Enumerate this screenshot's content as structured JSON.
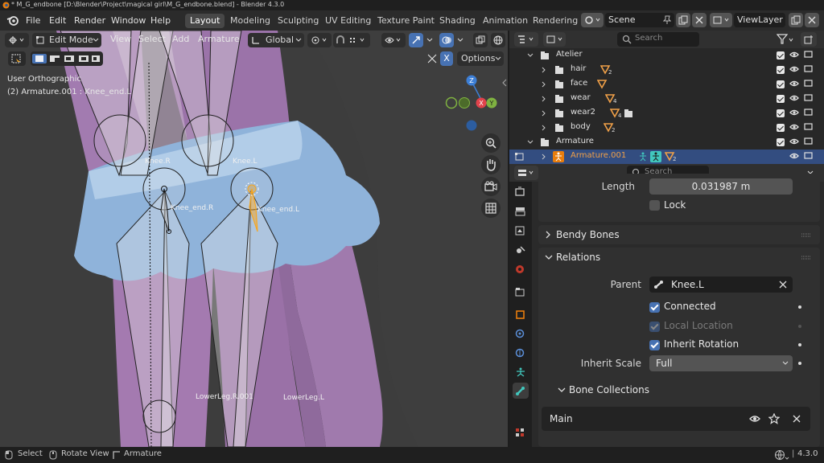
{
  "window": {
    "title": "* M_G_endbone [D:\\Blender\\Project\\magical girl\\M_G_endbone.blend] - Blender 4.3.0"
  },
  "menu": [
    "File",
    "Edit",
    "Render",
    "Window",
    "Help"
  ],
  "workspaces": [
    "Layout",
    "Modeling",
    "Sculpting",
    "UV Editing",
    "Texture Paint",
    "Shading",
    "Animation",
    "Rendering"
  ],
  "active_workspace": "Layout",
  "scene": {
    "name": "Scene",
    "view_layer": "ViewLayer"
  },
  "viewport": {
    "mode": "Edit Mode",
    "header_menus": [
      "View",
      "Select",
      "Add",
      "Armature"
    ],
    "orientation": "Global",
    "options_label": "Options",
    "xray_label": "X",
    "view_name": "User Orthographic",
    "active_object_info": "(2) Armature.001 : Knee_end.L",
    "bone_labels": {
      "knee_r": "Knee.R",
      "knee_l": "Knee.L",
      "knee_end_r": "Knee_end.R",
      "knee_end_l": "Knee_end.L",
      "lowerleg_r": "LowerLeg.R.001",
      "lowerleg_l": "LowerLeg.L"
    },
    "gizmo": {
      "x": "X",
      "y": "Y",
      "z": "Z"
    }
  },
  "outliner": {
    "search_placeholder": "Search",
    "rows": [
      {
        "name": "Atelier",
        "level": 0,
        "expanded": true
      },
      {
        "name": "hair",
        "level": 1,
        "badge": "2"
      },
      {
        "name": "face",
        "level": 1
      },
      {
        "name": "wear",
        "level": 1,
        "badge": "4"
      },
      {
        "name": "wear2",
        "level": 1,
        "badge": "4"
      },
      {
        "name": "body",
        "level": 1,
        "badge": "2"
      },
      {
        "name": "Armature",
        "level": 0,
        "expanded": true
      },
      {
        "name": "Armature.001",
        "level": 1,
        "selected": true,
        "badge": "2"
      }
    ]
  },
  "properties": {
    "search_placeholder": "Search",
    "length_label": "Length",
    "length_value": "0.031987 m",
    "lock_label": "Lock",
    "bendy_bones_label": "Bendy Bones",
    "relations_label": "Relations",
    "parent_label": "Parent",
    "parent_value": "Knee.L",
    "connected_label": "Connected",
    "connected": true,
    "local_location_label": "Local Location",
    "local_location": true,
    "inherit_rotation_label": "Inherit Rotation",
    "inherit_rotation": true,
    "inherit_scale_label": "Inherit Scale",
    "inherit_scale_value": "Full",
    "bone_collections_label": "Bone Collections",
    "collection_name": "Main"
  },
  "statusbar": {
    "select": "Select",
    "rotate": "Rotate View",
    "armature": "Armature",
    "version": "4.3.0"
  },
  "colors": {
    "accent": "#4772b3",
    "selection_row": "#334d80",
    "skirt": "#8fb3da",
    "legs": "#a47ab0",
    "active_bone": "#f5a623"
  }
}
